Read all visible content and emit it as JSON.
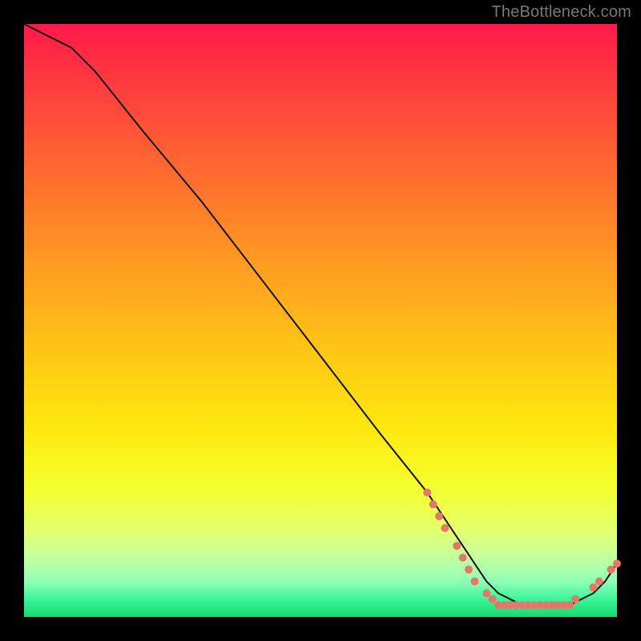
{
  "watermark": "TheBottleneck.com",
  "chart_data": {
    "type": "line",
    "title": "",
    "xlabel": "",
    "ylabel": "",
    "xlim": [
      0,
      100
    ],
    "ylim": [
      0,
      100
    ],
    "background_gradient": {
      "top": "#ff1a49",
      "upper_mid": "#ff9a22",
      "mid": "#ffe80f",
      "lower_mid": "#e6ff6a",
      "bottom": "#17d96e"
    },
    "series": [
      {
        "name": "bottleneck-curve",
        "color": "#111111",
        "x": [
          0,
          4,
          8,
          12,
          20,
          30,
          40,
          50,
          60,
          68,
          72,
          74,
          76,
          78,
          80,
          82,
          84,
          86,
          88,
          90,
          92,
          94,
          96,
          98,
          100
        ],
        "y": [
          100,
          98,
          96,
          92,
          82,
          70,
          57,
          44,
          31,
          21,
          15,
          12,
          9,
          6,
          4,
          3,
          2,
          2,
          2,
          2,
          2,
          3,
          4,
          6,
          9
        ]
      }
    ],
    "markers": {
      "name": "highlight-points",
      "color": "#e4766a",
      "points": [
        {
          "x": 68,
          "y": 21
        },
        {
          "x": 69,
          "y": 19
        },
        {
          "x": 70,
          "y": 17
        },
        {
          "x": 71,
          "y": 15
        },
        {
          "x": 73,
          "y": 12
        },
        {
          "x": 74,
          "y": 10
        },
        {
          "x": 75,
          "y": 8
        },
        {
          "x": 76,
          "y": 6
        },
        {
          "x": 78,
          "y": 4
        },
        {
          "x": 79,
          "y": 3
        },
        {
          "x": 80,
          "y": 2
        },
        {
          "x": 81,
          "y": 2
        },
        {
          "x": 82,
          "y": 2
        },
        {
          "x": 83,
          "y": 2
        },
        {
          "x": 84,
          "y": 2
        },
        {
          "x": 85,
          "y": 2
        },
        {
          "x": 86,
          "y": 2
        },
        {
          "x": 87,
          "y": 2
        },
        {
          "x": 88,
          "y": 2
        },
        {
          "x": 89,
          "y": 2
        },
        {
          "x": 90,
          "y": 2
        },
        {
          "x": 91,
          "y": 2
        },
        {
          "x": 92,
          "y": 2
        },
        {
          "x": 93,
          "y": 3
        },
        {
          "x": 96,
          "y": 5
        },
        {
          "x": 97,
          "y": 6
        },
        {
          "x": 99,
          "y": 8
        },
        {
          "x": 100,
          "y": 9
        }
      ]
    }
  }
}
